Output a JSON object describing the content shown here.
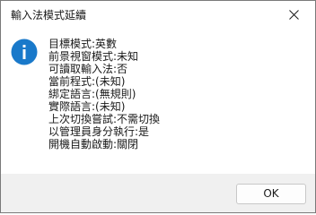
{
  "window": {
    "title": "輸入法模式延續"
  },
  "icon": {
    "name": "info-icon",
    "color": "#1979ca"
  },
  "messages": [
    "目標模式:英數",
    "前景視窗模式:未知",
    "可讀取輸入法:否",
    "當前程式:(未知)",
    "綁定語言:(無規則)",
    "實際語言:(未知)",
    "上次切換嘗試:不需切換",
    "以管理員身分執行:是",
    "開機自動啟動:關閉"
  ],
  "footer": {
    "ok_label": "OK"
  }
}
